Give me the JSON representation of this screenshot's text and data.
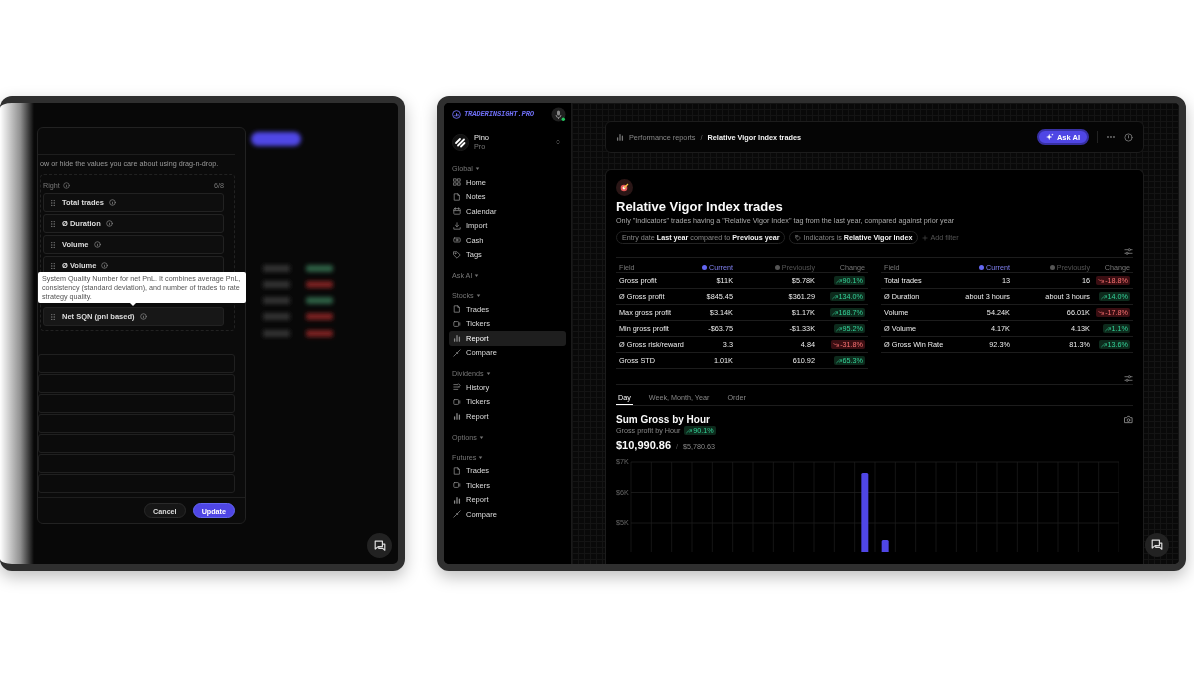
{
  "left_screen": {
    "modal": {
      "description": "ow or hide the values you care about using drag-n-drop.",
      "column_title": "Right",
      "count": "6/8",
      "items": [
        {
          "label": "Total trades",
          "hovered": false
        },
        {
          "label": "Ø Duration",
          "hovered": false
        },
        {
          "label": "Volume",
          "hovered": false
        },
        {
          "label": "Ø Volume",
          "hovered": false
        },
        {
          "label": "Net SQN (pnl based)",
          "hovered": true
        }
      ],
      "tooltip": "System Quality Number for net PnL. It combines average PnL, consistency (standard deviation), and number of trades to rate strategy quality.",
      "buttons": [
        {
          "label": "Cancel",
          "kind": "secondary"
        },
        {
          "label": "Update",
          "kind": "primary"
        }
      ]
    }
  },
  "right_screen": {
    "brand": "TRADERINSIGHT.PRO",
    "user": {
      "name": "Pino",
      "plan": "Pro"
    },
    "sidebar": {
      "sections": [
        {
          "title": "Global",
          "items": [
            {
              "label": "Home",
              "selected": false
            },
            {
              "label": "Notes",
              "selected": false
            },
            {
              "label": "Calendar",
              "selected": false
            },
            {
              "label": "Import",
              "selected": false
            },
            {
              "label": "Cash",
              "selected": false
            },
            {
              "label": "Tags",
              "selected": false
            }
          ]
        },
        {
          "title": "Ask AI"
        },
        {
          "title": "Stocks",
          "items": [
            {
              "label": "Trades",
              "selected": false
            },
            {
              "label": "Tickers",
              "selected": false
            },
            {
              "label": "Report",
              "selected": true
            },
            {
              "label": "Compare",
              "selected": false
            }
          ]
        },
        {
          "title": "Dividends",
          "items": [
            {
              "label": "History",
              "selected": false
            },
            {
              "label": "Tickers",
              "selected": false
            },
            {
              "label": "Report",
              "selected": false
            }
          ]
        },
        {
          "title": "Options"
        },
        {
          "title": "Futures",
          "items": [
            {
              "label": "Trades",
              "selected": false
            },
            {
              "label": "Tickers",
              "selected": false
            },
            {
              "label": "Report",
              "selected": false
            },
            {
              "label": "Compare",
              "selected": false
            }
          ]
        }
      ]
    },
    "breadcrumb": {
      "items": [
        "Performance reports",
        "Relative Vigor Index trades"
      ],
      "separator": "/"
    },
    "ask_ai": "Ask AI",
    "report": {
      "title": "Relative Vigor Index trades",
      "description": "Only \"Indicators\" trades having a \"Relative Vigor Index\" tag from the last year, compared against prior year",
      "filters": [
        {
          "text": "Entry date **Last year** compared to **Previous year**",
          "kind": "date"
        },
        {
          "text": "Indicators is **Relative Vigor Index**",
          "kind": "tag"
        }
      ],
      "add_filter": "Add filter",
      "tables": [
        {
          "columns": [
            {
              "label": "Field"
            },
            {
              "label": "Current",
              "color": "#6366f1"
            },
            {
              "label": "Previously",
              "color": "#555555"
            },
            {
              "label": "Change"
            }
          ],
          "rows": [
            {
              "field": "Gross profit",
              "current": "$11K",
              "previous": "$5.78K",
              "change": "90.1%",
              "rising": true
            },
            {
              "field": "Ø Gross profit",
              "current": "$845.45",
              "previous": "$361.29",
              "change": "134.0%",
              "rising": true
            },
            {
              "field": "Max gross profit",
              "current": "$3.14K",
              "previous": "$1.17K",
              "change": "168.7%",
              "rising": true
            },
            {
              "field": "Min gross profit",
              "current": "-$63.75",
              "previous": "-$1.33K",
              "change": "95.2%",
              "rising": true
            },
            {
              "field": "Ø Gross risk/reward",
              "current": "3.3",
              "previous": "4.84",
              "change": "-31.8%",
              "rising": false
            },
            {
              "field": "Gross STD",
              "current": "1.01K",
              "previous": "610.92",
              "change": "65.3%",
              "rising": true
            }
          ]
        },
        {
          "columns": [
            {
              "label": "Field"
            },
            {
              "label": "Current",
              "color": "#6366f1"
            },
            {
              "label": "Previously",
              "color": "#555555"
            },
            {
              "label": "Change"
            }
          ],
          "rows": [
            {
              "field": "Total trades",
              "current": "13",
              "previous": "16",
              "change": "-18.8%",
              "rising": false
            },
            {
              "field": "Ø Duration",
              "current": "about 3 hours",
              "previous": "about 3 hours",
              "change": "14.0%",
              "rising": true
            },
            {
              "field": "Volume",
              "current": "54.24K",
              "previous": "66.01K",
              "change": "-17.8%",
              "rising": false
            },
            {
              "field": "Ø Volume",
              "current": "4.17K",
              "previous": "4.13K",
              "change": "1.1%",
              "rising": true
            },
            {
              "field": "Ø Gross Win Rate",
              "current": "92.3%",
              "previous": "81.3%",
              "change": "13.6%",
              "rising": true
            }
          ]
        }
      ],
      "tabs": [
        {
          "label": "Day",
          "selected": true
        },
        {
          "label": "Week, Month, Year",
          "selected": false
        },
        {
          "label": "Order",
          "selected": false
        }
      ],
      "chart": {
        "title": "Sum Gross by Hour",
        "subtitle": "Gross profit by Hour",
        "change": "90.1%",
        "rising": true,
        "value": "$10,990.86",
        "separator": "/",
        "previous": "$5,780.63",
        "chart_data": {
          "type": "bar",
          "values": [
            null,
            null,
            null,
            null,
            null,
            null,
            null,
            null,
            null,
            null,
            null,
            6640,
            4440,
            null,
            null,
            null,
            null,
            null,
            null,
            null,
            null,
            null,
            null,
            null
          ],
          "ylim": [
            4050,
            7000
          ],
          "yticks": [
            {
              "value": 5000,
              "label": "$5K"
            },
            {
              "value": 6000,
              "label": "$6K"
            },
            {
              "value": 7000,
              "label": "$7K"
            }
          ]
        }
      }
    }
  }
}
